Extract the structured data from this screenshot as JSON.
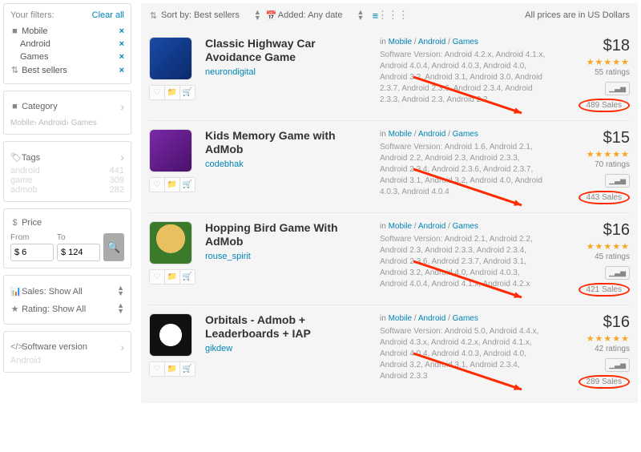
{
  "sidebar": {
    "filters_label": "Your filters:",
    "clear_all": "Clear all",
    "filters": [
      {
        "label": "Mobile",
        "indent": 0
      },
      {
        "label": "Android",
        "indent": 1
      },
      {
        "label": "Games",
        "indent": 1
      },
      {
        "label": "Best sellers",
        "indent": 0,
        "icon": "sort"
      }
    ],
    "category": {
      "label": "Category",
      "crumb": "Mobile› Android› Games"
    },
    "tags": {
      "label": "Tags",
      "items": [
        {
          "name": "android",
          "count": "441"
        },
        {
          "name": "game",
          "count": "309"
        },
        {
          "name": "admob",
          "count": "282"
        }
      ]
    },
    "price": {
      "label": "Price",
      "from_label": "From",
      "to_label": "To",
      "from": "$ 6",
      "to": "$ 124"
    },
    "sales_label": "Sales: Show All",
    "rating_label": "Rating: Show All",
    "software": {
      "label": "Software version",
      "items": [
        {
          "name": "Android",
          "count": ""
        }
      ]
    }
  },
  "topbar": {
    "sort_label": "Sort by: Best sellers",
    "added_label": "Added: Any date",
    "currency_note": "All prices are in US Dollars"
  },
  "items": [
    {
      "title": "Classic Highway Car Avoidance Game",
      "author": "neurondigital",
      "breadcrumb_prefix": "in ",
      "bc1": "Mobile",
      "bc2": "Android",
      "bc3": "Games",
      "meta": "Software Version: Android 4.2.x, Android 4.1.x, Android 4.0.4, Android 4.0.3, Android 4.0, Android 3.2, Android 3.1, Android 3.0, Android 2.3.7, Android 2.3.6, Android 2.3.4, Android 2.3.3, Android 2.3, Android 2.2",
      "price": "$18",
      "stars": 4.5,
      "ratings": "55 ratings",
      "sales": "489 Sales",
      "thumb": "t0"
    },
    {
      "title": "Kids Memory Game with AdMob",
      "author": "codebhak",
      "breadcrumb_prefix": "in ",
      "bc1": "Mobile",
      "bc2": "Android",
      "bc3": "Games",
      "meta": "Software Version: Android 1.6, Android 2.1, Android 2.2, Android 2.3, Android 2.3.3, Android 2.3.4, Android 2.3.6, Android 2.3.7, Android 3.1, Android 3.2, Android 4.0, Android 4.0.3, Android 4.0.4",
      "price": "$15",
      "stars": 4.5,
      "ratings": "70 ratings",
      "sales": "443 Sales",
      "thumb": "t1"
    },
    {
      "title": "Hopping Bird Game With AdMob",
      "author": "rouse_spirit",
      "breadcrumb_prefix": "in ",
      "bc1": "Mobile",
      "bc2": "Android",
      "bc3": "Games",
      "meta": "Software Version: Android 2.1, Android 2.2, Android 2.3, Android 2.3.3, Android 2.3.4, Android 2.3.6, Android 2.3.7, Android 3.1, Android 3.2, Android 4.0, Android 4.0.3, Android 4.0.4, Android 4.1.x, Android 4.2.x",
      "price": "$16",
      "stars": 4.5,
      "ratings": "45 ratings",
      "sales": "421 Sales",
      "thumb": "t2"
    },
    {
      "title": "Orbitals - Admob + Leaderboards + IAP",
      "author": "gikdew",
      "breadcrumb_prefix": "in ",
      "bc1": "Mobile",
      "bc2": "Android",
      "bc3": "Games",
      "meta": "Software Version: Android 5.0, Android 4.4.x, Android 4.3.x, Android 4.2.x, Android 4.1.x, Android 4.0.4, Android 4.0.3, Android 4.0, Android 3.2, Android 3.1, Android 2.3.4, Android 2.3.3",
      "price": "$16",
      "stars": 4.5,
      "ratings": "42 ratings",
      "sales": "289 Sales",
      "thumb": "t3"
    }
  ]
}
